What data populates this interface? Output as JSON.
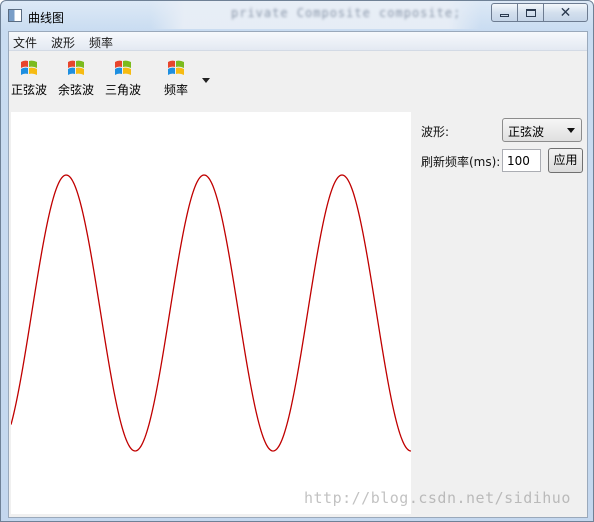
{
  "window": {
    "title": "曲线图",
    "background_blur_text": "private Composite composite;"
  },
  "menu": {
    "items": [
      "文件",
      "波形",
      "频率"
    ]
  },
  "toolbar": {
    "buttons": [
      {
        "label": "正弦波",
        "icon": "windows-logo-icon"
      },
      {
        "label": "余弦波",
        "icon": "windows-logo-icon"
      },
      {
        "label": "三角波",
        "icon": "windows-logo-icon"
      },
      {
        "label": "频率",
        "icon": "windows-logo-icon"
      }
    ]
  },
  "controls": {
    "waveform_label": "波形:",
    "waveform_value": "正弦波",
    "refresh_label": "刷新频率(ms):",
    "refresh_value": "100",
    "apply_label": "应用"
  },
  "watermark": "http://blog.csdn.net/sidihuo",
  "colors": {
    "curve": "#c00000",
    "plot_background": "#ffffff"
  },
  "chart_data": {
    "type": "line",
    "function": "sine",
    "cycles_visible": 2.9,
    "line_color": "#c00000"
  }
}
